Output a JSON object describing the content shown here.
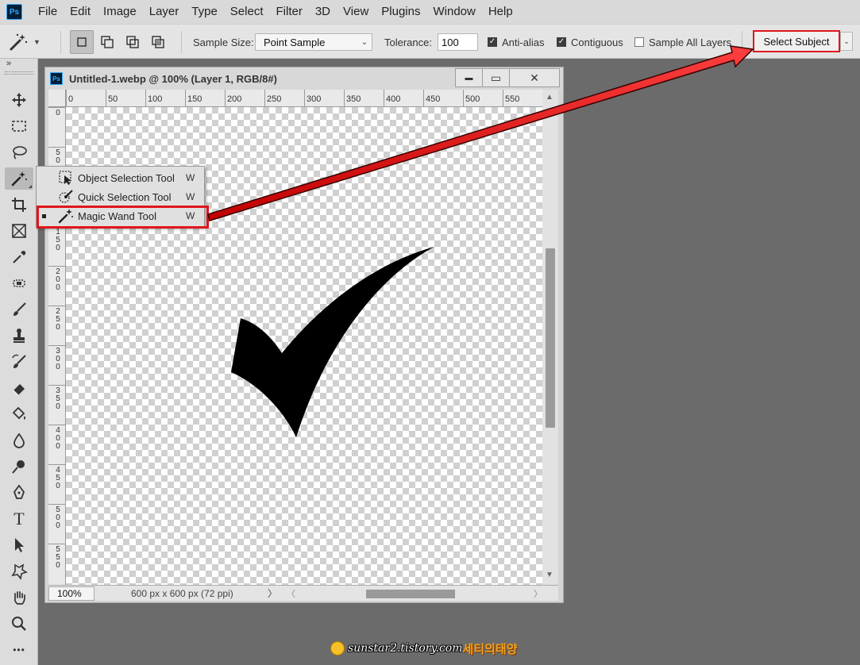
{
  "app": {
    "logo": "Ps"
  },
  "menu": [
    "File",
    "Edit",
    "Image",
    "Layer",
    "Type",
    "Select",
    "Filter",
    "3D",
    "View",
    "Plugins",
    "Window",
    "Help"
  ],
  "options": {
    "tool_icon": "magic-wand-icon",
    "sample_size_label": "Sample Size:",
    "sample_size_value": "Point Sample",
    "tolerance_label": "Tolerance:",
    "tolerance_value": "100",
    "anti_alias_label": "Anti-alias",
    "anti_alias_checked": true,
    "contiguous_label": "Contiguous",
    "contiguous_checked": true,
    "sample_all_layers_label": "Sample All Layers",
    "sample_all_layers_checked": false,
    "select_subject_label": "Select Subject"
  },
  "toolbar": {
    "collapse_label": "»",
    "tools": [
      "move-icon",
      "rectangular-marquee-icon",
      "lasso-icon",
      "magic-wand-icon",
      "crop-icon",
      "frame-icon",
      "eyedropper-icon",
      "spot-healing-icon",
      "brush-icon",
      "clone-stamp-icon",
      "history-brush-icon",
      "eraser-icon",
      "paint-bucket-icon",
      "blur-icon",
      "dodge-icon",
      "pen-icon",
      "type-icon",
      "path-selection-icon",
      "custom-shape-icon",
      "hand-icon",
      "zoom-icon",
      "more-icon"
    ],
    "type_tool_label": "T",
    "more_label": "•••"
  },
  "flyout": {
    "items": [
      {
        "label": "Object Selection Tool",
        "shortcut": "W",
        "icon": "object-selection-icon",
        "selected": false
      },
      {
        "label": "Quick Selection Tool",
        "shortcut": "W",
        "icon": "quick-selection-icon",
        "selected": false
      },
      {
        "label": "Magic Wand Tool",
        "shortcut": "W",
        "icon": "magic-wand-icon",
        "selected": true
      }
    ]
  },
  "document": {
    "title": "Untitled-1.webp @ 100% (Layer 1, RGB/8#)",
    "ps_icon": "Ps",
    "controls": {
      "minimize": "▬",
      "maximize": "▭",
      "close": "✕"
    },
    "ruler_h": [
      "0",
      "50",
      "100",
      "150",
      "200",
      "250",
      "300",
      "350",
      "400",
      "450",
      "500",
      "550"
    ],
    "ruler_v": [
      "0",
      "50",
      "100",
      "150",
      "200",
      "250",
      "300",
      "350",
      "400",
      "450",
      "500",
      "550"
    ],
    "zoom": "100%",
    "info": "600 px x 600 px (72 ppi)",
    "info_arrow": "〉"
  },
  "watermark": {
    "url": "sunstar2.tistory.com",
    "name": "세티의태양"
  },
  "colors": {
    "highlight": "#e0161d",
    "canvas_check": "#d0d0d0",
    "ui_bg": "#6b6b6b"
  }
}
